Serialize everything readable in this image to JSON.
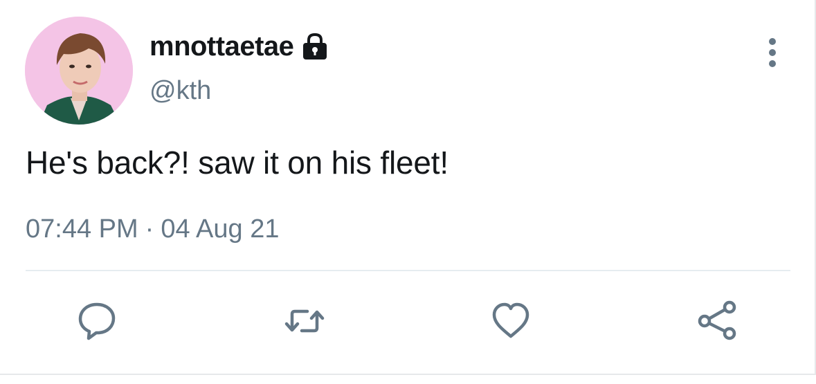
{
  "tweet": {
    "display_name": "mnottaetae",
    "handle": "@kth",
    "text": "He's back?! saw it on his fleet!",
    "time": "07:44 PM",
    "separator": "·",
    "date": "04 Aug 21"
  },
  "icons": {
    "lock": "lock-icon",
    "more": "more-vertical-icon",
    "reply": "reply-icon",
    "retweet": "retweet-icon",
    "like": "heart-icon",
    "share": "share-icon"
  },
  "colors": {
    "text_primary": "#14171a",
    "text_secondary": "#657786",
    "icon": "#657786",
    "avatar_bg": "#f4c4e6",
    "divider": "#e6ecf0"
  }
}
